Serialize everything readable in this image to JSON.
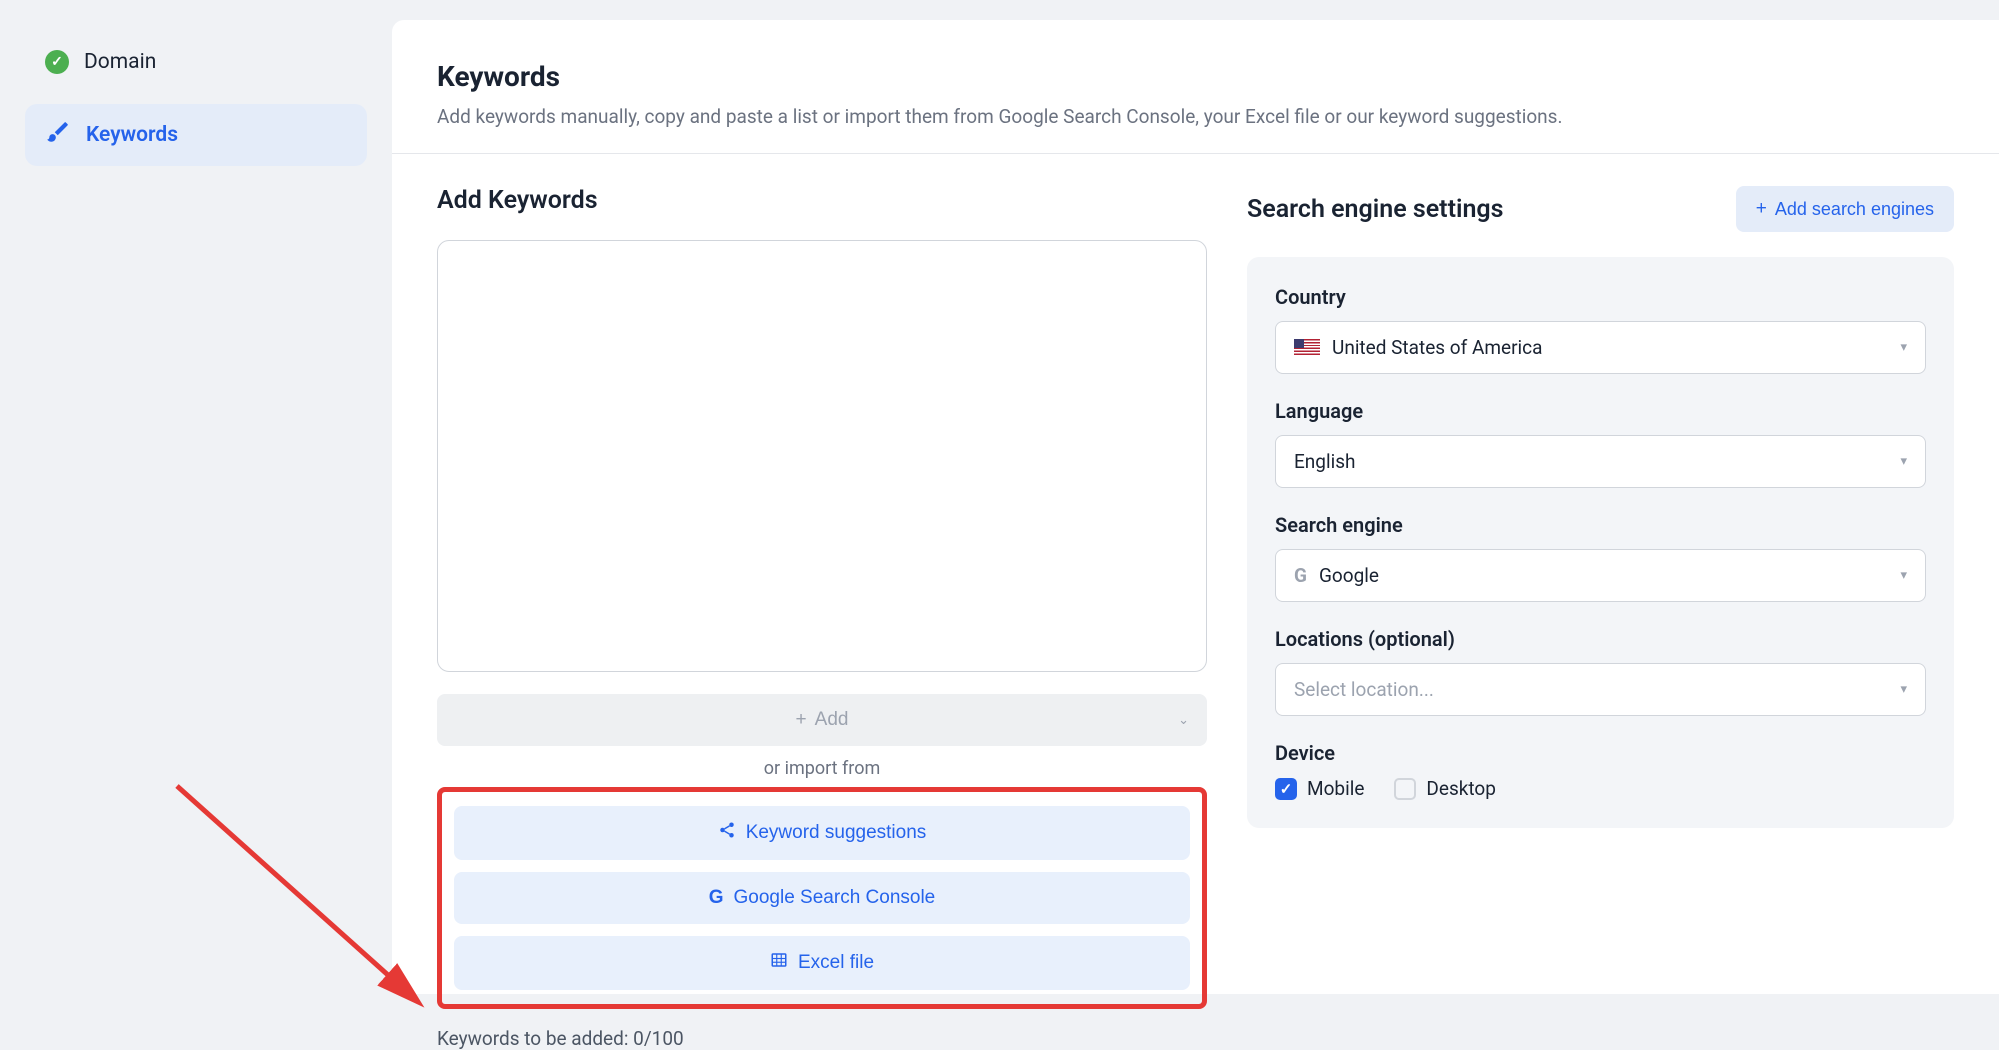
{
  "sidebar": {
    "items": [
      {
        "label": "Domain",
        "status": "completed"
      },
      {
        "label": "Keywords",
        "status": "active"
      }
    ]
  },
  "header": {
    "title": "Keywords",
    "subtitle": "Add keywords manually, copy and paste a list or import them from Google Search Console, your Excel file or our keyword suggestions."
  },
  "addKeywords": {
    "title": "Add Keywords",
    "addButtonLabel": "Add",
    "orImportLabel": "or import from",
    "importOptions": [
      {
        "label": "Keyword suggestions",
        "icon": "share"
      },
      {
        "label": "Google Search Console",
        "icon": "google"
      },
      {
        "label": "Excel file",
        "icon": "excel"
      }
    ],
    "counterLabel": "Keywords to be added: 0/100"
  },
  "searchEngineSettings": {
    "title": "Search engine settings",
    "addButtonLabel": "Add search engines",
    "fields": {
      "country": {
        "label": "Country",
        "value": "United States of America"
      },
      "language": {
        "label": "Language",
        "value": "English"
      },
      "searchEngine": {
        "label": "Search engine",
        "value": "Google"
      },
      "locations": {
        "label": "Locations (optional)",
        "placeholder": "Select location..."
      },
      "device": {
        "label": "Device",
        "options": [
          {
            "label": "Mobile",
            "checked": true
          },
          {
            "label": "Desktop",
            "checked": false
          }
        ]
      }
    }
  }
}
